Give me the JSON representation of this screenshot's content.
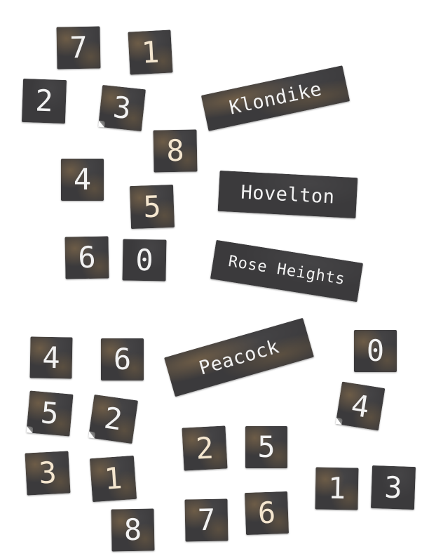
{
  "colors": {
    "background": "#ffffff",
    "tile": "#3b3a3c",
    "text": "#f2f2f2",
    "stain": "#967850"
  },
  "labels": {
    "klondike": "Klondike",
    "hovelton": "Hovelton",
    "rose_heights": "Rose Heights",
    "peacock": "Peacock"
  },
  "top_numbers": [
    "7",
    "1",
    "2",
    "3",
    "8",
    "4",
    "5",
    "6",
    "0"
  ],
  "bottom_numbers": [
    "4",
    "6",
    "0",
    "5",
    "2",
    "4",
    "3",
    "1",
    "2",
    "5",
    "1",
    "3",
    "8",
    "7",
    "6"
  ]
}
